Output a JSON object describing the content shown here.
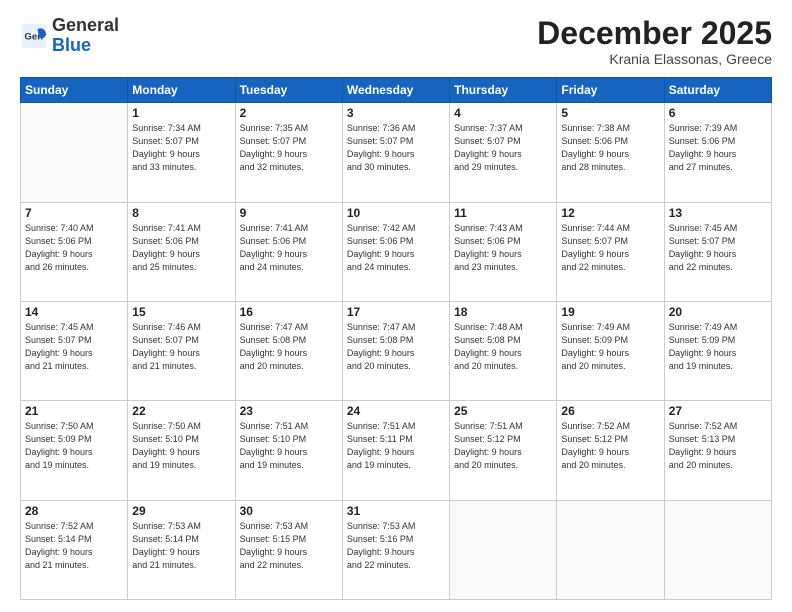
{
  "header": {
    "logo_general": "General",
    "logo_blue": "Blue",
    "month_year": "December 2025",
    "location": "Krania Elassonas, Greece"
  },
  "weekdays": [
    "Sunday",
    "Monday",
    "Tuesday",
    "Wednesday",
    "Thursday",
    "Friday",
    "Saturday"
  ],
  "weeks": [
    [
      {
        "day": "",
        "info": ""
      },
      {
        "day": "1",
        "info": "Sunrise: 7:34 AM\nSunset: 5:07 PM\nDaylight: 9 hours\nand 33 minutes."
      },
      {
        "day": "2",
        "info": "Sunrise: 7:35 AM\nSunset: 5:07 PM\nDaylight: 9 hours\nand 32 minutes."
      },
      {
        "day": "3",
        "info": "Sunrise: 7:36 AM\nSunset: 5:07 PM\nDaylight: 9 hours\nand 30 minutes."
      },
      {
        "day": "4",
        "info": "Sunrise: 7:37 AM\nSunset: 5:07 PM\nDaylight: 9 hours\nand 29 minutes."
      },
      {
        "day": "5",
        "info": "Sunrise: 7:38 AM\nSunset: 5:06 PM\nDaylight: 9 hours\nand 28 minutes."
      },
      {
        "day": "6",
        "info": "Sunrise: 7:39 AM\nSunset: 5:06 PM\nDaylight: 9 hours\nand 27 minutes."
      }
    ],
    [
      {
        "day": "7",
        "info": "Sunrise: 7:40 AM\nSunset: 5:06 PM\nDaylight: 9 hours\nand 26 minutes."
      },
      {
        "day": "8",
        "info": "Sunrise: 7:41 AM\nSunset: 5:06 PM\nDaylight: 9 hours\nand 25 minutes."
      },
      {
        "day": "9",
        "info": "Sunrise: 7:41 AM\nSunset: 5:06 PM\nDaylight: 9 hours\nand 24 minutes."
      },
      {
        "day": "10",
        "info": "Sunrise: 7:42 AM\nSunset: 5:06 PM\nDaylight: 9 hours\nand 24 minutes."
      },
      {
        "day": "11",
        "info": "Sunrise: 7:43 AM\nSunset: 5:06 PM\nDaylight: 9 hours\nand 23 minutes."
      },
      {
        "day": "12",
        "info": "Sunrise: 7:44 AM\nSunset: 5:07 PM\nDaylight: 9 hours\nand 22 minutes."
      },
      {
        "day": "13",
        "info": "Sunrise: 7:45 AM\nSunset: 5:07 PM\nDaylight: 9 hours\nand 22 minutes."
      }
    ],
    [
      {
        "day": "14",
        "info": "Sunrise: 7:45 AM\nSunset: 5:07 PM\nDaylight: 9 hours\nand 21 minutes."
      },
      {
        "day": "15",
        "info": "Sunrise: 7:46 AM\nSunset: 5:07 PM\nDaylight: 9 hours\nand 21 minutes."
      },
      {
        "day": "16",
        "info": "Sunrise: 7:47 AM\nSunset: 5:08 PM\nDaylight: 9 hours\nand 20 minutes."
      },
      {
        "day": "17",
        "info": "Sunrise: 7:47 AM\nSunset: 5:08 PM\nDaylight: 9 hours\nand 20 minutes."
      },
      {
        "day": "18",
        "info": "Sunrise: 7:48 AM\nSunset: 5:08 PM\nDaylight: 9 hours\nand 20 minutes."
      },
      {
        "day": "19",
        "info": "Sunrise: 7:49 AM\nSunset: 5:09 PM\nDaylight: 9 hours\nand 20 minutes."
      },
      {
        "day": "20",
        "info": "Sunrise: 7:49 AM\nSunset: 5:09 PM\nDaylight: 9 hours\nand 19 minutes."
      }
    ],
    [
      {
        "day": "21",
        "info": "Sunrise: 7:50 AM\nSunset: 5:09 PM\nDaylight: 9 hours\nand 19 minutes."
      },
      {
        "day": "22",
        "info": "Sunrise: 7:50 AM\nSunset: 5:10 PM\nDaylight: 9 hours\nand 19 minutes."
      },
      {
        "day": "23",
        "info": "Sunrise: 7:51 AM\nSunset: 5:10 PM\nDaylight: 9 hours\nand 19 minutes."
      },
      {
        "day": "24",
        "info": "Sunrise: 7:51 AM\nSunset: 5:11 PM\nDaylight: 9 hours\nand 19 minutes."
      },
      {
        "day": "25",
        "info": "Sunrise: 7:51 AM\nSunset: 5:12 PM\nDaylight: 9 hours\nand 20 minutes."
      },
      {
        "day": "26",
        "info": "Sunrise: 7:52 AM\nSunset: 5:12 PM\nDaylight: 9 hours\nand 20 minutes."
      },
      {
        "day": "27",
        "info": "Sunrise: 7:52 AM\nSunset: 5:13 PM\nDaylight: 9 hours\nand 20 minutes."
      }
    ],
    [
      {
        "day": "28",
        "info": "Sunrise: 7:52 AM\nSunset: 5:14 PM\nDaylight: 9 hours\nand 21 minutes."
      },
      {
        "day": "29",
        "info": "Sunrise: 7:53 AM\nSunset: 5:14 PM\nDaylight: 9 hours\nand 21 minutes."
      },
      {
        "day": "30",
        "info": "Sunrise: 7:53 AM\nSunset: 5:15 PM\nDaylight: 9 hours\nand 22 minutes."
      },
      {
        "day": "31",
        "info": "Sunrise: 7:53 AM\nSunset: 5:16 PM\nDaylight: 9 hours\nand 22 minutes."
      },
      {
        "day": "",
        "info": ""
      },
      {
        "day": "",
        "info": ""
      },
      {
        "day": "",
        "info": ""
      }
    ]
  ]
}
